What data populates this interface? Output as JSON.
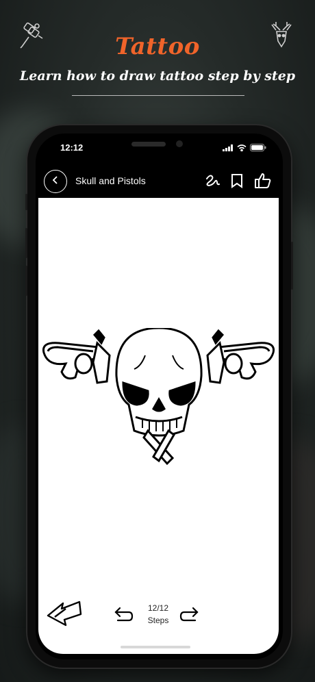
{
  "header": {
    "app_title": "Tattoo",
    "tagline": "Learn how to draw tattoo step by step"
  },
  "icons": {
    "left_corner": "tattoo-machine-icon",
    "right_corner": "deer-skull-icon"
  },
  "status_bar": {
    "time": "12:12"
  },
  "nav": {
    "title": "Skull and Pistols",
    "actions": [
      "stroke-icon",
      "bookmark-icon",
      "like-icon"
    ]
  },
  "drawing": {
    "subject": "skull-and-pistols-icon"
  },
  "stepper": {
    "counter": "12/12",
    "label": "Steps"
  },
  "colors": {
    "accent": "#f0642a",
    "canvas": "#ffffff",
    "phone": "#0c0c0c"
  }
}
